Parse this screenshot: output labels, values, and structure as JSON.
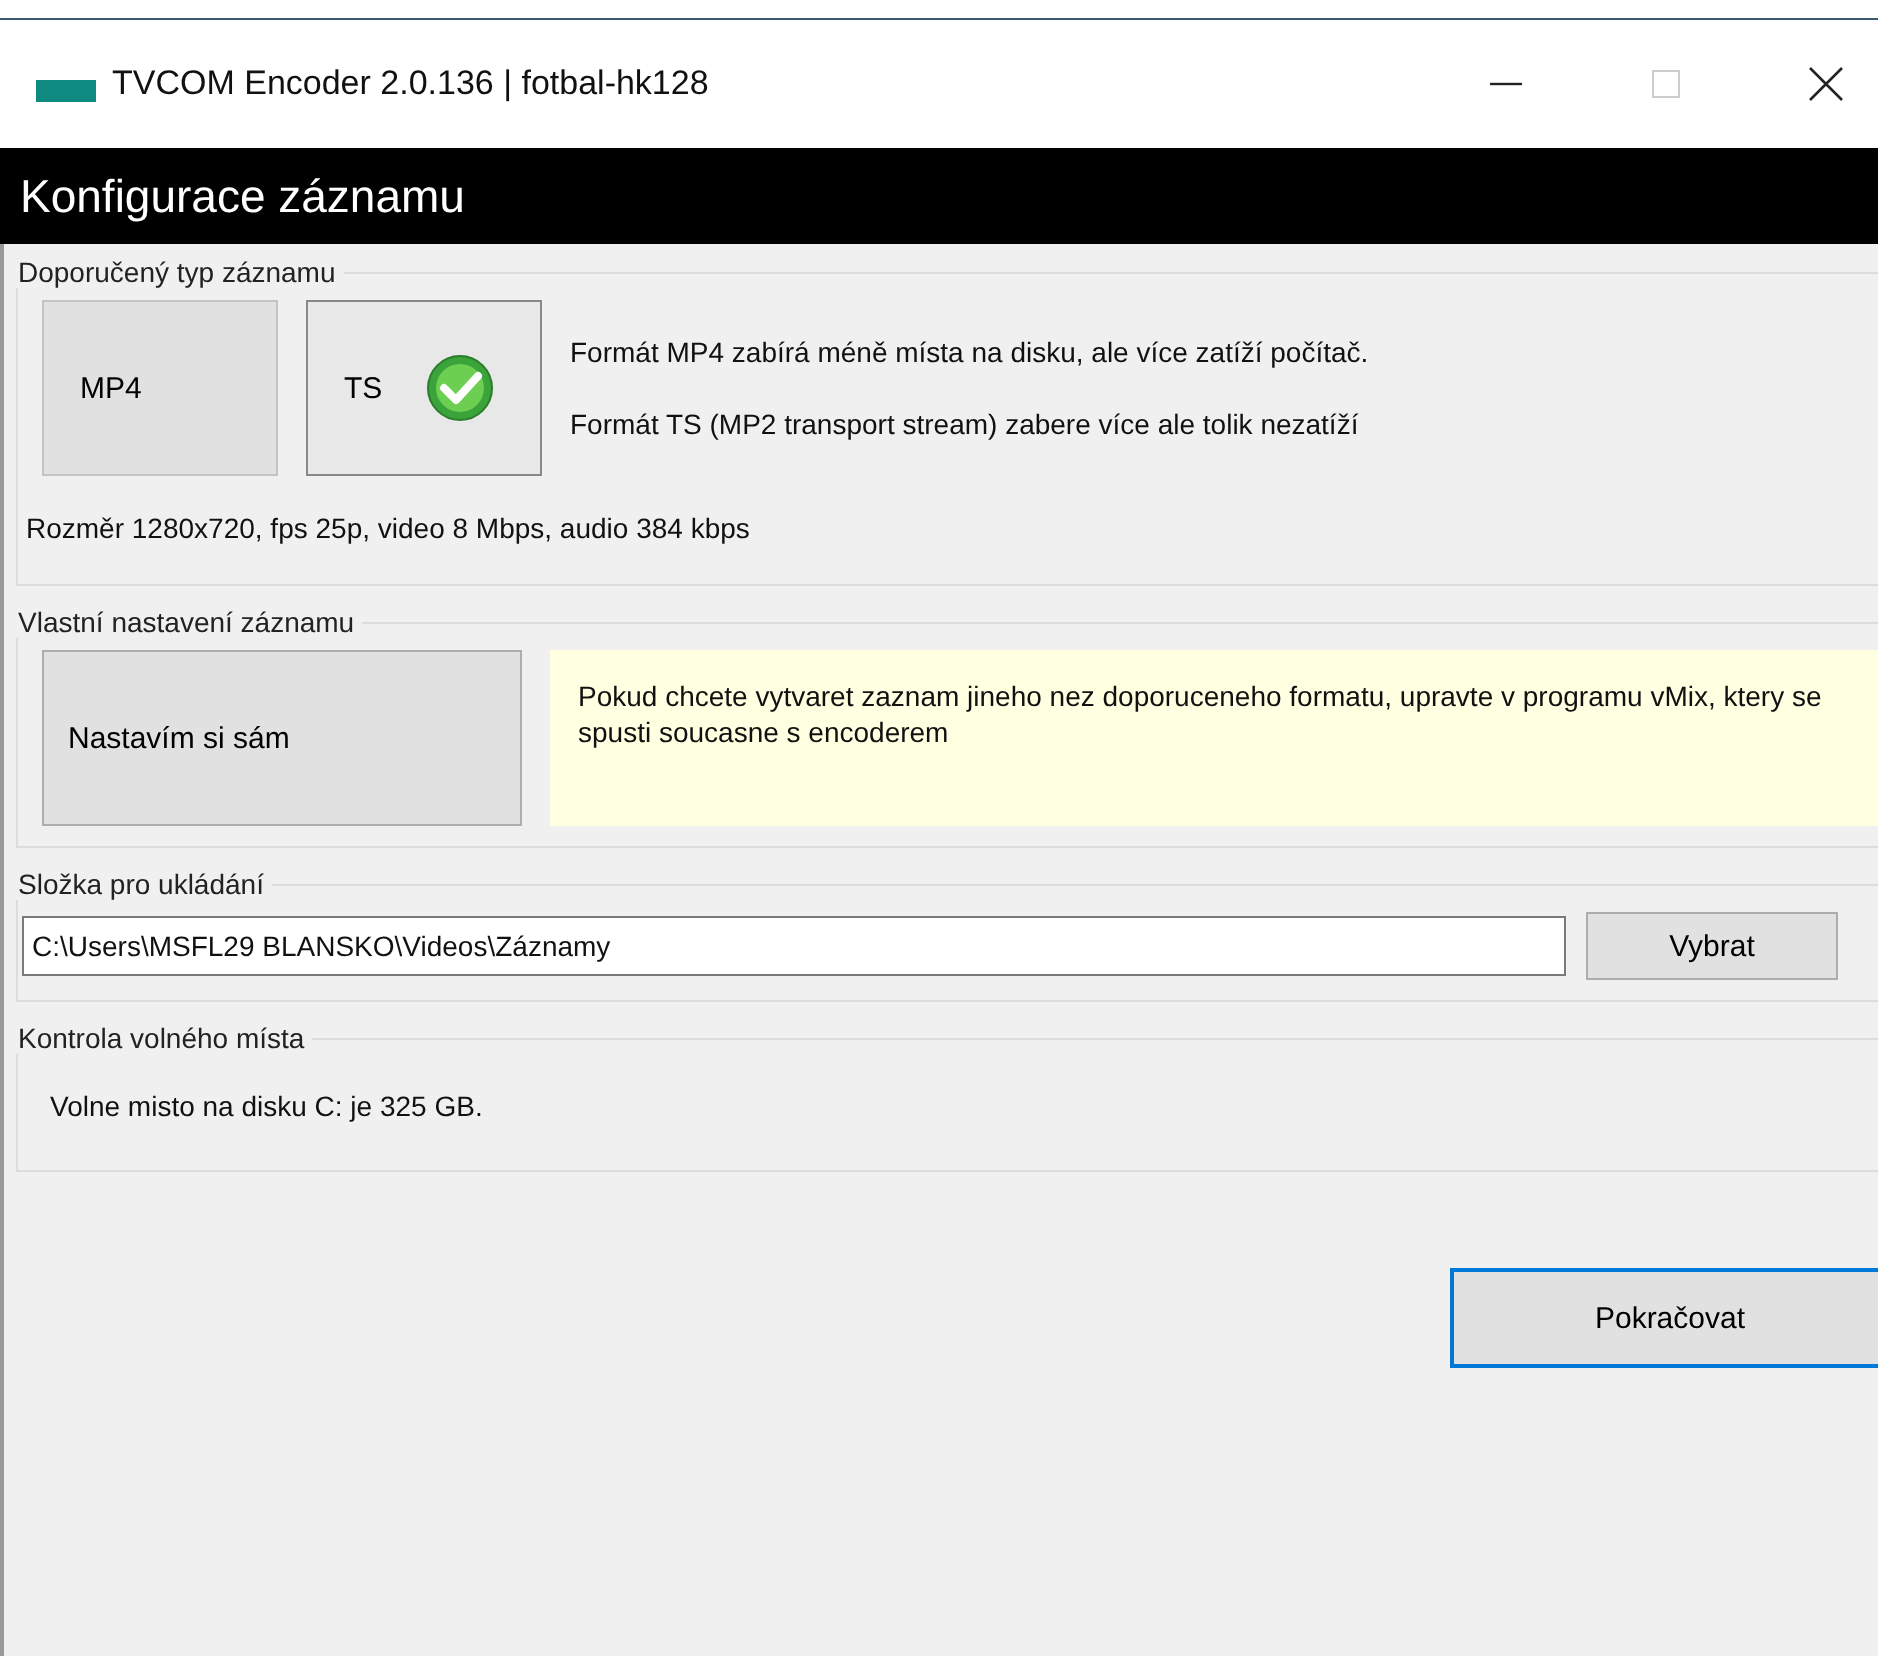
{
  "window": {
    "title": "TVCOM Encoder 2.0.136 | fotbal-hk128"
  },
  "header": "Konfigurace záznamu",
  "recommended": {
    "legend": "Doporučený typ záznamu",
    "formats": [
      {
        "label": "MP4",
        "selected": false
      },
      {
        "label": "TS",
        "selected": true
      }
    ],
    "notes": [
      "Formát MP4 zabírá méně místa na disku, ale více zatíží počítač.",
      "Formát TS (MP2 transport stream) zabere více ale tolik nezatíží"
    ],
    "details": "Rozměr 1280x720, fps 25p, video 8 Mbps, audio 384 kbps"
  },
  "custom": {
    "legend": "Vlastní nastavení záznamu",
    "button": "Nastavím si sám",
    "hint": "Pokud chcete vytvaret zaznam jineho nez doporuceneho formatu, upravte v programu vMix, ktery se spusti soucasne s encoderem"
  },
  "folder": {
    "legend": "Složka pro ukládání",
    "path": "C:\\Users\\MSFL29 BLANSKO\\Videos\\Záznamy",
    "button": "Vybrat"
  },
  "space": {
    "legend": "Kontrola volného místa",
    "message": "Volne misto na disku C: je 325 GB."
  },
  "continue_button": "Pokračovat"
}
